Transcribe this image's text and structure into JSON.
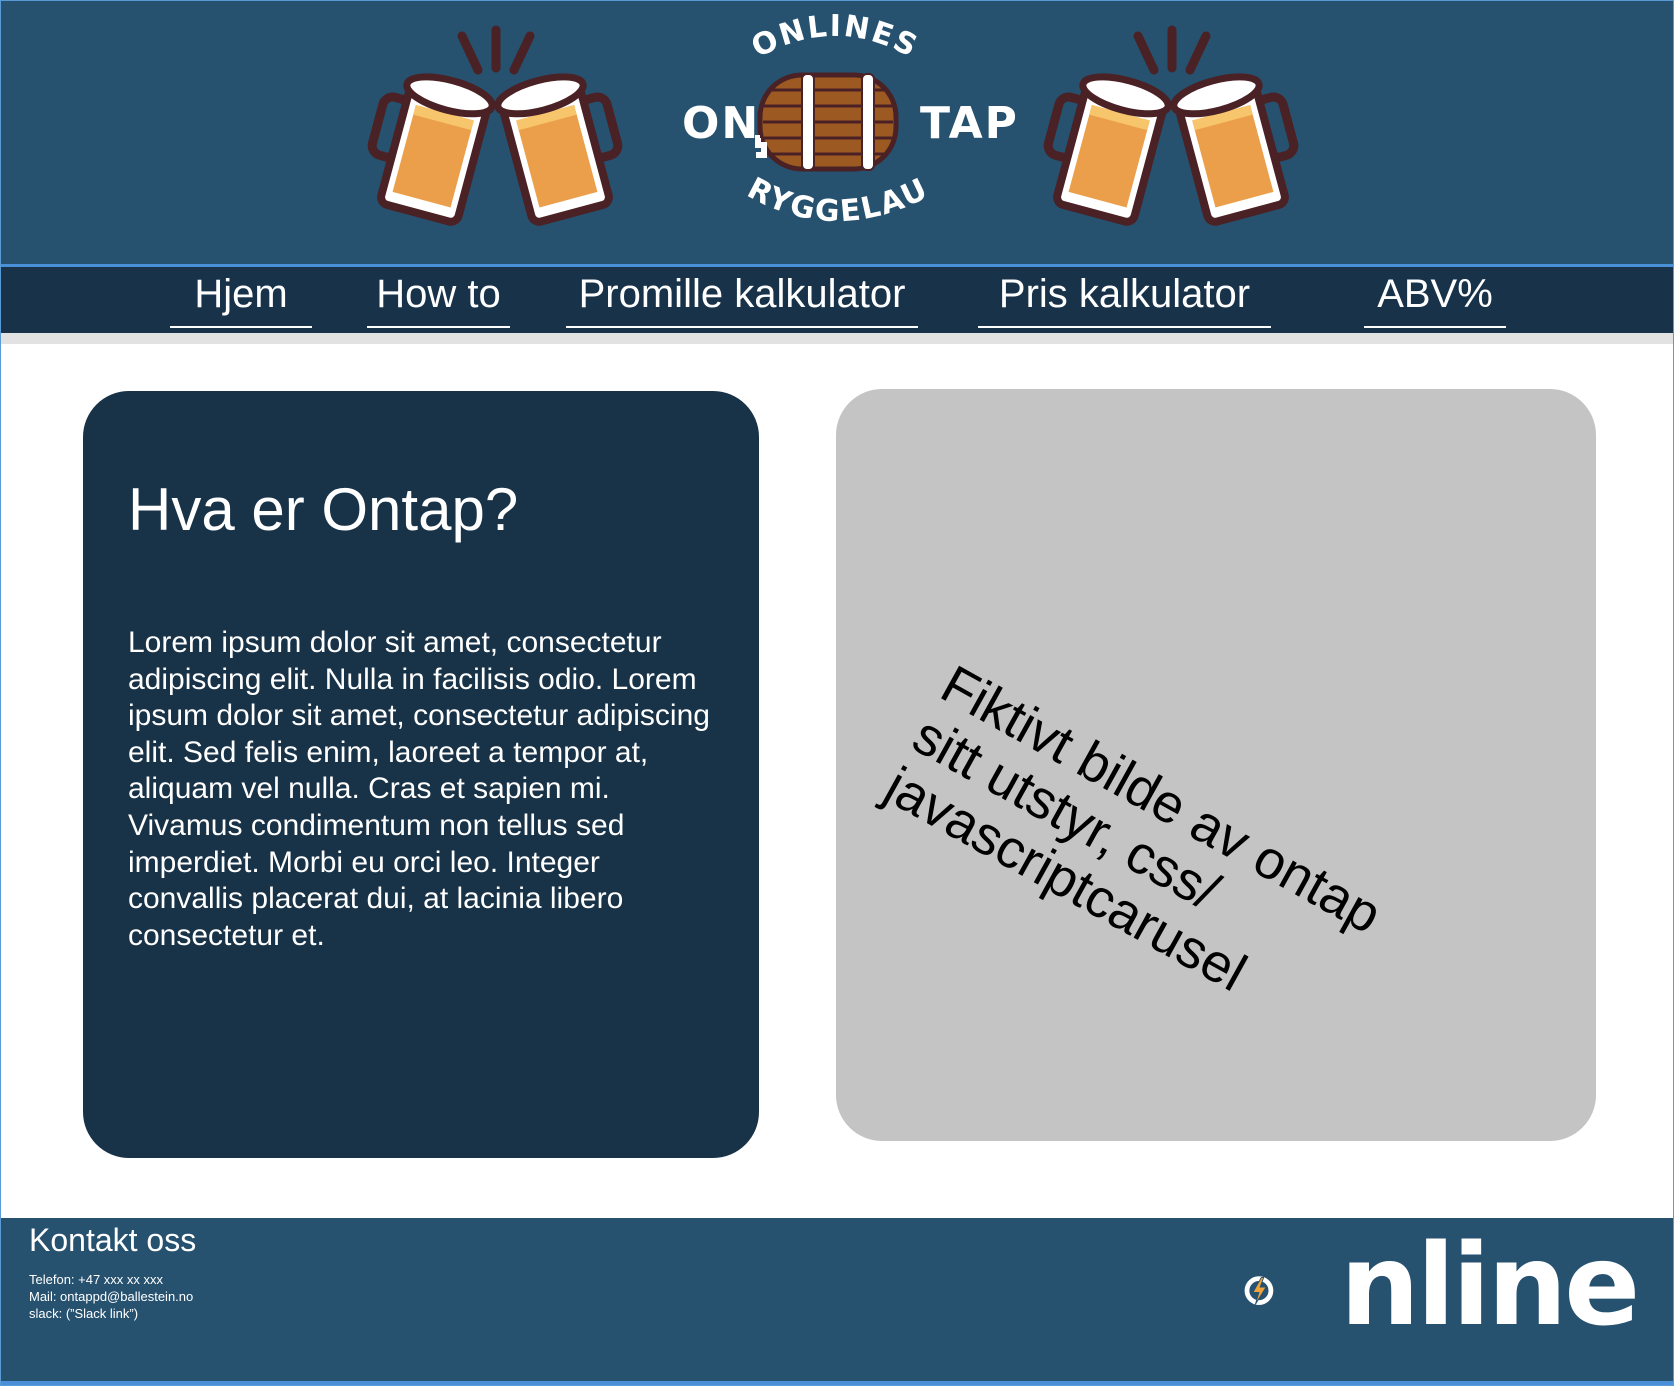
{
  "header": {
    "logo": {
      "arc_top": "ONLINES",
      "left": "ON",
      "right": "TAP",
      "arc_bottom": "BRYGGELAUG"
    }
  },
  "nav": {
    "items": [
      {
        "label": "Hjem"
      },
      {
        "label": "How to"
      },
      {
        "label": "Promille kalkulator"
      },
      {
        "label": "Pris kalkulator"
      },
      {
        "label": "ABV%"
      }
    ]
  },
  "main": {
    "info_card": {
      "title": "Hva er Ontap?",
      "body": "Lorem ipsum dolor sit amet, consectetur adipiscing elit. Nulla in facilisis odio. Lorem ipsum dolor sit amet, consectetur adipiscing elit. Sed felis enim, laoreet a tempor at, aliquam vel nulla. Cras et sapien mi. Vivamus condimentum non tellus sed imperdiet. Morbi eu orci leo. Integer convallis placerat dui, at lacinia libero consectetur et."
    },
    "image_placeholder": {
      "text": "Fiktivt bilde av ontap sitt utstyr, css/ javascriptcarusel"
    }
  },
  "footer": {
    "title": "Kontakt oss",
    "phone": "Telefon: +47 xxx xx xxx",
    "mail": "Mail: ontappd@ballestein.no",
    "slack": "slack: (”Slack link”)",
    "logo_text": "nline"
  },
  "colors": {
    "header_bg": "#265270",
    "nav_bg": "#18324a",
    "card_dark": "#183247",
    "card_gray": "#c4c4c4",
    "accent_line": "#4a90d9",
    "bolt": "#f0a33a"
  },
  "icons": [
    "beer-mugs-icon",
    "barrel-icon",
    "lightning-bolt-icon"
  ]
}
